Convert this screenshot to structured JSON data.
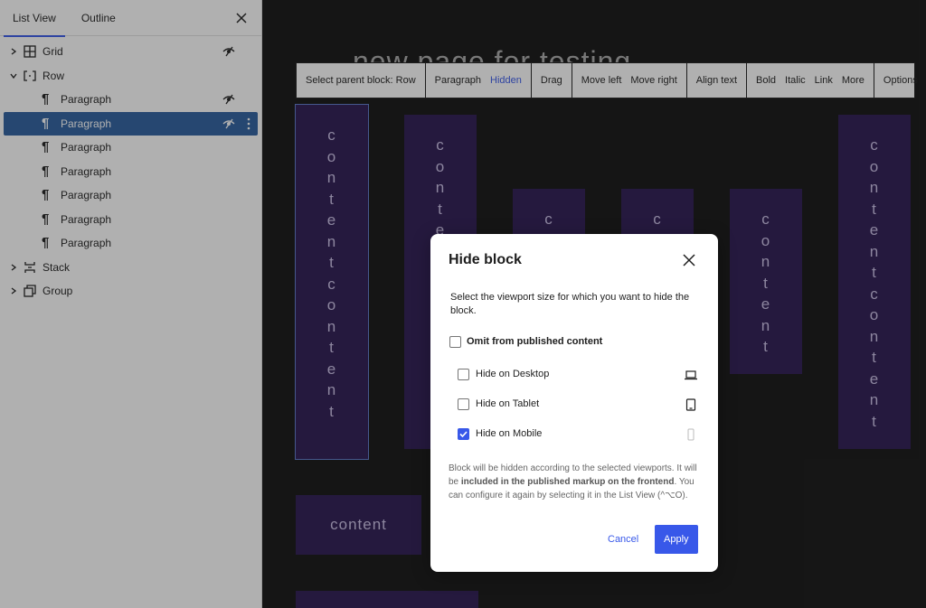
{
  "sidebar": {
    "tabs": [
      {
        "label": "List View",
        "active": true
      },
      {
        "label": "Outline",
        "active": false
      }
    ],
    "items": [
      {
        "label": "Grid",
        "icon": "grid-icon",
        "hidden": true,
        "expanded": false
      },
      {
        "label": "Row",
        "icon": "row-icon",
        "hidden": false,
        "expanded": true
      },
      {
        "label": "Paragraph",
        "icon": "paragraph-icon",
        "hidden": true
      },
      {
        "label": "Paragraph",
        "icon": "paragraph-icon",
        "hidden": true,
        "selected": true
      },
      {
        "label": "Paragraph",
        "icon": "paragraph-icon",
        "hidden": false
      },
      {
        "label": "Paragraph",
        "icon": "paragraph-icon",
        "hidden": false
      },
      {
        "label": "Paragraph",
        "icon": "paragraph-icon",
        "hidden": false
      },
      {
        "label": "Paragraph",
        "icon": "paragraph-icon",
        "hidden": false
      },
      {
        "label": "Paragraph",
        "icon": "paragraph-icon",
        "hidden": false
      },
      {
        "label": "Stack",
        "icon": "stack-icon",
        "hidden": false,
        "expanded": false
      },
      {
        "label": "Group",
        "icon": "group-icon",
        "hidden": false,
        "expanded": false
      }
    ]
  },
  "canvas": {
    "page_title": "new page for testing",
    "toolbar": {
      "select_parent": "Select parent block: Row",
      "paragraph": "Paragraph",
      "hidden": "Hidden",
      "drag": "Drag",
      "move_left": "Move left",
      "move_right": "Move right",
      "align_text": "Align text",
      "bold": "Bold",
      "italic": "Italic",
      "link": "Link",
      "more": "More",
      "options": "Options"
    },
    "block_text": "content"
  },
  "modal": {
    "title": "Hide block",
    "description": "Select the viewport size for which you want to hide the block.",
    "omit_label": "Omit from published content",
    "options": [
      {
        "label": "Hide on Desktop",
        "checked": false,
        "icon": "desktop-icon"
      },
      {
        "label": "Hide on Tablet",
        "checked": false,
        "icon": "tablet-icon"
      },
      {
        "label": "Hide on Mobile",
        "checked": true,
        "icon": "mobile-icon"
      }
    ],
    "note_part1": "Block will be hidden according to the selected viewports. It will be ",
    "note_bold": "included in the published markup on the frontend",
    "note_part2": ". You can configure it again by selecting it in the List View (^⌥O).",
    "cancel_label": "Cancel",
    "apply_label": "Apply"
  },
  "colors": {
    "accent": "#3858e9",
    "block_bg": "#2a1750",
    "selected_row": "#2c5f9e"
  }
}
